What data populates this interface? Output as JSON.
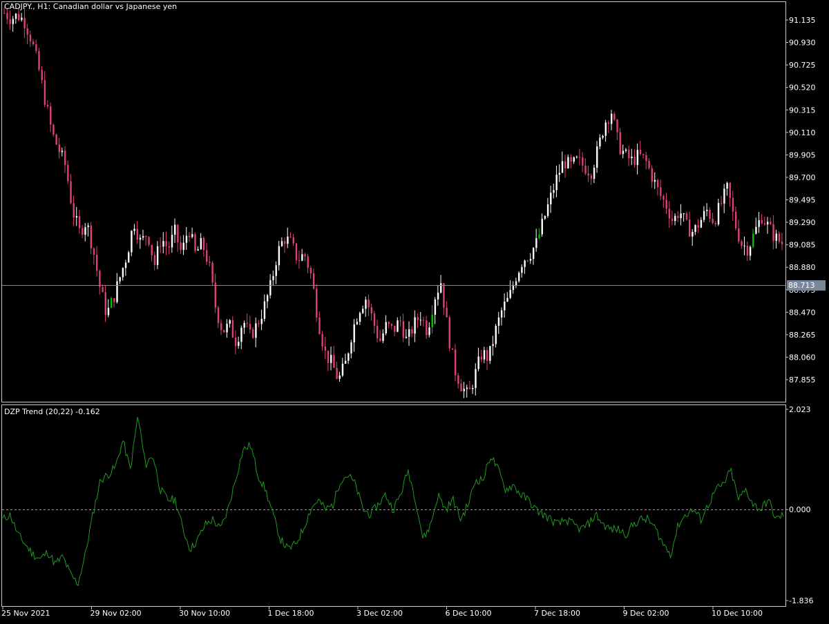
{
  "header": {
    "symbol_title": "CADJPY., H1:  Canadian dollar vs Japanese yen",
    "indicator_title": "DZP Trend (20,22) -0.162"
  },
  "colors": {
    "background": "#000000",
    "frame": "#c8c8c8",
    "bear_candle": "#e0407a",
    "bull_candle": "#ffffff",
    "bull_highlight": "#00c000",
    "indicator_line": "#1f9a1f",
    "zero_line": "#a0a0a0",
    "bid_line": "#778899"
  },
  "chart_data": [
    {
      "type": "candlestick",
      "title": "CADJPY., H1:  Canadian dollar vs Japanese yen",
      "y_ticks": [
        "91.135",
        "90.930",
        "90.725",
        "90.520",
        "90.315",
        "90.110",
        "89.905",
        "89.700",
        "89.495",
        "89.290",
        "89.085",
        "88.880",
        "88.675",
        "88.470",
        "88.265",
        "88.060",
        "87.855"
      ],
      "ylim": [
        87.7,
        91.25
      ],
      "current_price": "88.713",
      "x_ticks": [
        "25 Nov 2021",
        "29 Nov 02:00",
        "30 Nov 10:00",
        "1 Dec 18:00",
        "3 Dec 02:00",
        "6 Dec 10:00",
        "7 Dec 18:00",
        "9 Dec 02:00",
        "10 Dec 10:00"
      ],
      "close_path": [
        91.2,
        91.15,
        91.18,
        91.12,
        90.95,
        90.7,
        90.4,
        90.1,
        89.95,
        89.8,
        89.4,
        89.2,
        89.3,
        89.05,
        88.7,
        88.45,
        88.6,
        88.8,
        89.0,
        89.3,
        89.1,
        89.2,
        88.9,
        89.15,
        89.05,
        89.2,
        89.0,
        89.25,
        89.0,
        89.1,
        88.9,
        88.5,
        88.3,
        88.35,
        88.2,
        88.4,
        88.25,
        88.35,
        88.5,
        88.7,
        89.0,
        89.15,
        89.1,
        88.95,
        89.0,
        88.8,
        88.4,
        88.1,
        88.0,
        87.85,
        88.0,
        88.3,
        88.5,
        88.6,
        88.4,
        88.2,
        88.35,
        88.3,
        88.4,
        88.2,
        88.35,
        88.45,
        88.3,
        88.6,
        88.75,
        88.3,
        87.95,
        87.8,
        87.7,
        87.9,
        88.1,
        88.05,
        88.3,
        88.5,
        88.6,
        88.8,
        88.95,
        89.0,
        89.1,
        89.3,
        89.5,
        89.7,
        89.85,
        89.8,
        89.85,
        89.8,
        89.75,
        89.95,
        90.2,
        90.3,
        90.0,
        89.9,
        89.85,
        89.9,
        89.85,
        89.7,
        89.55,
        89.45,
        89.3,
        89.4,
        89.25,
        89.2,
        89.3,
        89.4,
        89.3,
        89.45,
        89.6,
        89.3,
        89.1,
        89.05,
        89.2,
        89.35,
        89.25,
        89.15,
        89.1
      ],
      "series": [
        {
          "name": "CADJPY.",
          "values": [
            91.2,
            91.15,
            91.18,
            91.12,
            90.95,
            90.7,
            90.4,
            90.1,
            89.95,
            89.8,
            89.4,
            89.2,
            89.3,
            89.05,
            88.7,
            88.45,
            88.6,
            88.8,
            89.0,
            89.3,
            89.1,
            89.2,
            88.9,
            89.15,
            89.05,
            89.2,
            89.0,
            89.25,
            89.0,
            89.1,
            88.9,
            88.5,
            88.3,
            88.35,
            88.2,
            88.4,
            88.25,
            88.35,
            88.5,
            88.7,
            89.0,
            89.15,
            89.1,
            88.95,
            89.0,
            88.8,
            88.4,
            88.1,
            88.0,
            87.85,
            88.0,
            88.3,
            88.5,
            88.6,
            88.4,
            88.2,
            88.35,
            88.3,
            88.4,
            88.2,
            88.35,
            88.45,
            88.3,
            88.6,
            88.75,
            88.3,
            87.95,
            87.8,
            87.7,
            87.9,
            88.1,
            88.05,
            88.3,
            88.5,
            88.6,
            88.8,
            88.95,
            89.0,
            89.1,
            89.3,
            89.5,
            89.7,
            89.85,
            89.8,
            89.85,
            89.8,
            89.75,
            89.95,
            90.2,
            90.3,
            90.0,
            89.9,
            89.85,
            89.9,
            89.85,
            89.7,
            89.55,
            89.45,
            89.3,
            89.4,
            89.25,
            89.2,
            89.3,
            89.4,
            89.3,
            89.45,
            89.6,
            89.3,
            89.1,
            89.05,
            89.2,
            89.35,
            89.25,
            89.15,
            89.1
          ]
        }
      ],
      "candle_count": 270
    },
    {
      "type": "line",
      "title": "DZP Trend (20,22) -0.162",
      "y_ticks": [
        "2.023",
        "0.000",
        "-1.836"
      ],
      "ylim": [
        -1.836,
        2.023
      ],
      "zero_line": 0.0,
      "path": [
        -0.2,
        -0.1,
        -0.5,
        -0.7,
        -0.9,
        -1.0,
        -0.85,
        -1.1,
        -0.95,
        -1.3,
        -1.5,
        -0.9,
        -0.1,
        0.6,
        0.7,
        0.85,
        1.4,
        0.8,
        1.9,
        0.9,
        1.1,
        0.4,
        0.2,
        0.2,
        -0.4,
        -0.8,
        -0.6,
        -0.3,
        -0.2,
        -0.4,
        0.0,
        0.6,
        1.2,
        1.3,
        0.7,
        0.4,
        -0.1,
        -0.6,
        -0.8,
        -0.7,
        -0.4,
        0.0,
        0.2,
        0.0,
        0.1,
        0.6,
        0.7,
        0.5,
        0.0,
        -0.1,
        0.1,
        0.3,
        0.0,
        0.3,
        0.8,
        0.2,
        -0.6,
        -0.3,
        0.3,
        0.0,
        0.2,
        -0.2,
        0.1,
        0.6,
        0.6,
        1.1,
        0.8,
        0.4,
        0.5,
        0.3,
        0.2,
        0.0,
        -0.1,
        -0.2,
        -0.3,
        -0.2,
        -0.3,
        -0.4,
        -0.3,
        -0.1,
        -0.3,
        -0.4,
        -0.4,
        -0.5,
        -0.3,
        -0.2,
        -0.2,
        -0.4,
        -0.7,
        -0.9,
        -0.3,
        -0.1,
        0.0,
        -0.2,
        0.1,
        0.4,
        0.5,
        0.8,
        0.2,
        0.4,
        0.1,
        0.0,
        0.2,
        -0.2,
        -0.1
      ]
    }
  ]
}
